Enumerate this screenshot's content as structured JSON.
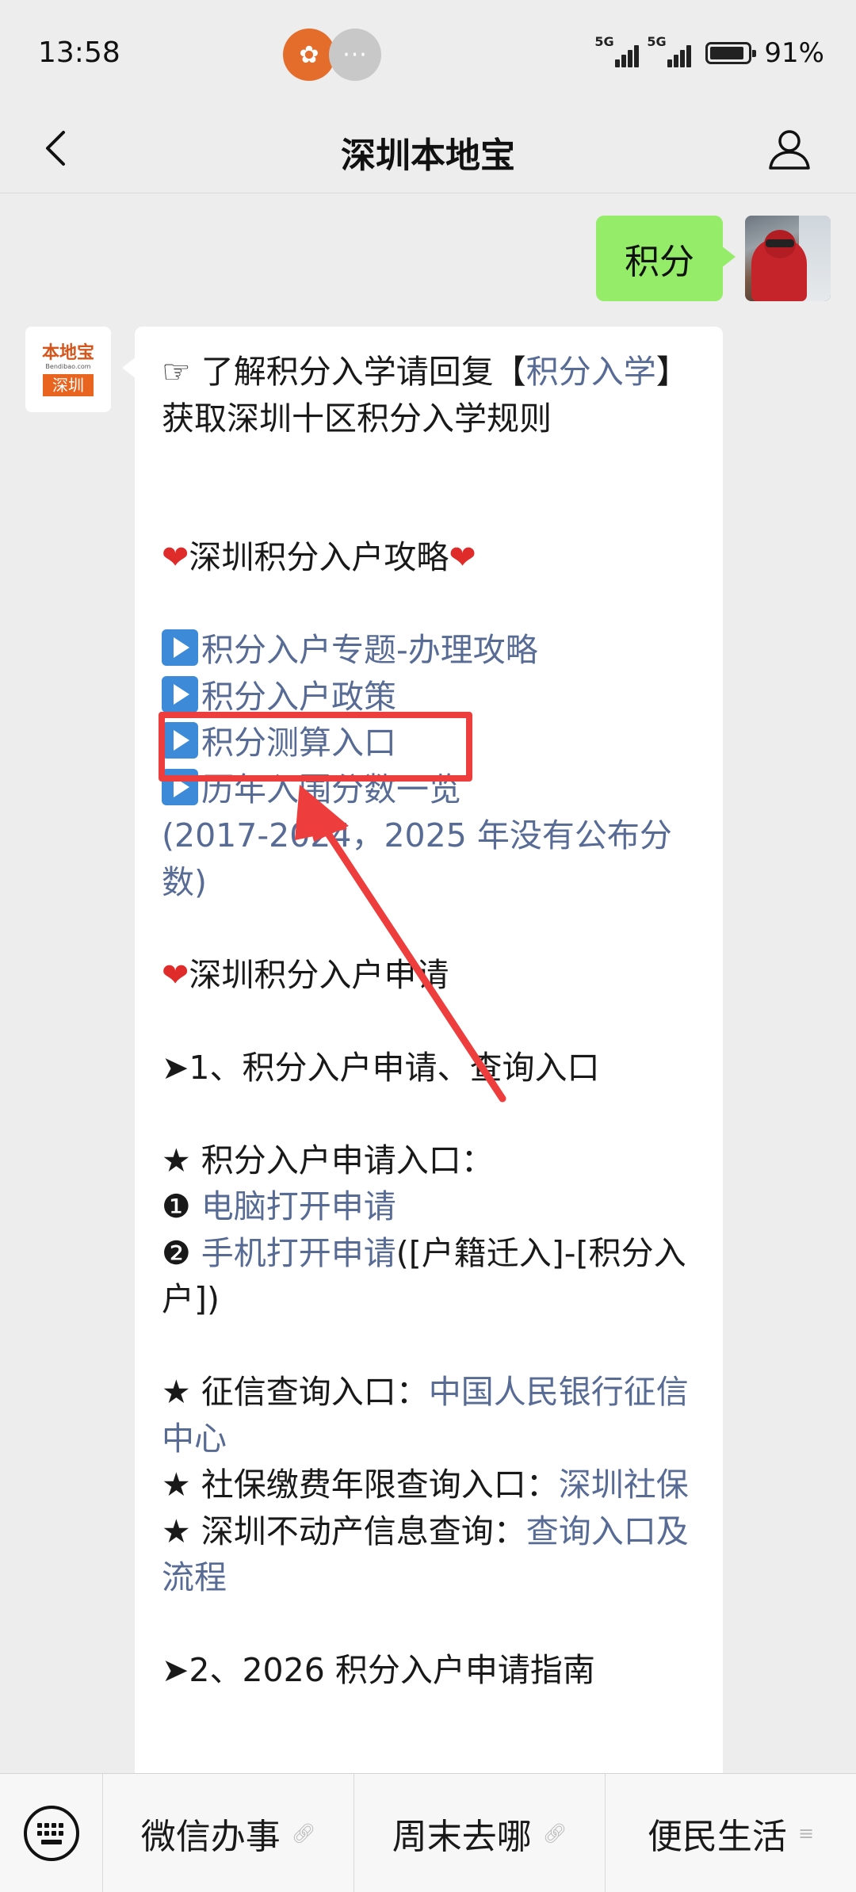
{
  "status_bar": {
    "time": "13:58",
    "battery_text": "91%",
    "battery_level": 0.91,
    "network_1": "5G",
    "network_2": "5G"
  },
  "header": {
    "title": "深圳本地宝"
  },
  "outgoing": {
    "text": "积分"
  },
  "bot_avatar": {
    "brand": "本地宝",
    "sub": "Bendibao.com",
    "city": "深圳"
  },
  "message": {
    "intro_prefix": "☞ 了解积分入学请回复【",
    "intro_link": "积分入学",
    "intro_suffix": "】获取深圳十区积分入学规则",
    "section1_title": "深圳积分入户攻略",
    "link1": "积分入户专题-办理攻略",
    "link2": "积分入户政策",
    "link3": "积分测算入口",
    "link4": "历年入围分数一览",
    "link4_note": "(2017-2024，2025 年没有公布分数)",
    "section2_title": "深圳积分入户申请",
    "step1": "➤1、积分入户申请、查询入口",
    "apply_label": "★ 积分入户申请入口：",
    "apply_num1": "❶ ",
    "apply_link1": "电脑打开申请",
    "apply_num2": "❷ ",
    "apply_link2": "手机打开申请",
    "apply_link2_note": "([户籍迁入]-[积分入户])",
    "credit_label": "★ 征信查询入口：",
    "credit_link": "中国人民银行征信中心",
    "social_label": "★ 社保缴费年限查询入口：",
    "social_link": "深圳社保",
    "property_label": "★ 深圳不动产信息查询：",
    "property_link": "查询入口及流程",
    "step2": "➤2、2026 积分入户申请指南"
  },
  "bottom_menu": {
    "items": [
      "微信办事",
      "周末去哪",
      "便民生活"
    ]
  },
  "colors": {
    "link": "#576b95",
    "outgoing_bubble": "#95ec69",
    "annotation": "#ee3d3d",
    "background": "#ededed"
  }
}
